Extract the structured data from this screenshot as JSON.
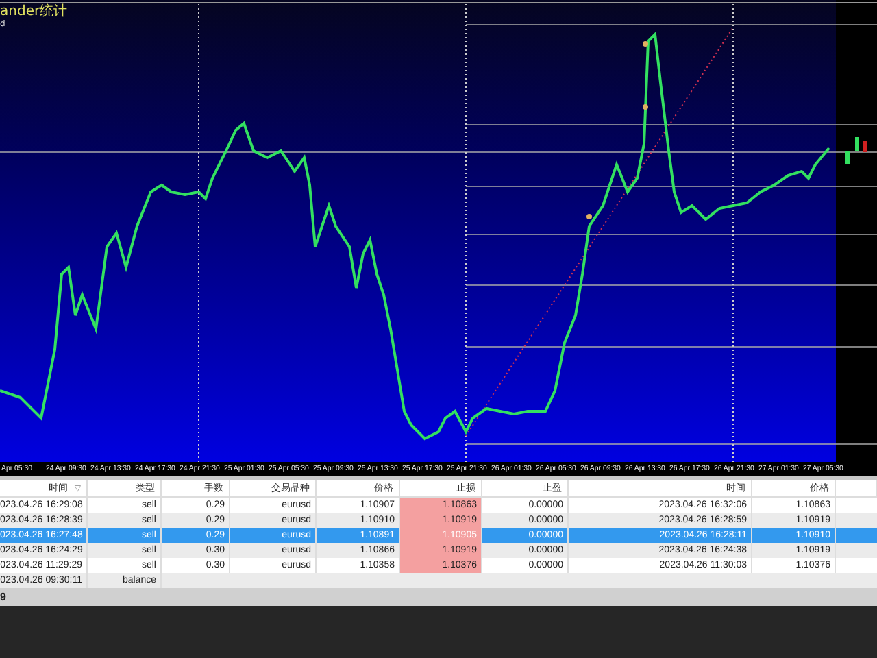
{
  "chart": {
    "title_lines": [
      "ander统计",
      "d"
    ],
    "time_axis": [
      "Apr 05:30",
      "24 Apr 09:30",
      "24 Apr 13:30",
      "24 Apr 17:30",
      "24 Apr 21:30",
      "25 Apr 01:30",
      "25 Apr 05:30",
      "25 Apr 09:30",
      "25 Apr 13:30",
      "25 Apr 17:30",
      "25 Apr 21:30",
      "26 Apr 01:30",
      "26 Apr 05:30",
      "26 Apr 09:30",
      "26 Apr 13:30",
      "26 Apr 17:30",
      "26 Apr 21:30",
      "27 Apr 01:30",
      "27 Apr 05:30"
    ]
  },
  "table": {
    "columns": [
      {
        "label": "时间",
        "sort_mark": "▽"
      },
      {
        "label": "类型"
      },
      {
        "label": "手数"
      },
      {
        "label": "交易品种"
      },
      {
        "label": "价格"
      },
      {
        "label": "止损"
      },
      {
        "label": "止盈"
      },
      {
        "label": "时间"
      },
      {
        "label": "价格"
      }
    ],
    "rows": [
      {
        "selected": false,
        "stop_loss_highlight": true,
        "cells": [
          "023.04.26 16:29:08",
          "sell",
          "0.29",
          "eurusd",
          "1.10907",
          "1.10863",
          "0.00000",
          "2023.04.26 16:32:06",
          "1.10863"
        ]
      },
      {
        "selected": false,
        "stop_loss_highlight": true,
        "cells": [
          "023.04.26 16:28:39",
          "sell",
          "0.29",
          "eurusd",
          "1.10910",
          "1.10919",
          "0.00000",
          "2023.04.26 16:28:59",
          "1.10919"
        ]
      },
      {
        "selected": true,
        "stop_loss_highlight": true,
        "cells": [
          "023.04.26 16:27:48",
          "sell",
          "0.29",
          "eurusd",
          "1.10891",
          "1.10905",
          "0.00000",
          "2023.04.26 16:28:11",
          "1.10910"
        ]
      },
      {
        "selected": false,
        "stop_loss_highlight": true,
        "cells": [
          "023.04.26 16:24:29",
          "sell",
          "0.30",
          "eurusd",
          "1.10866",
          "1.10919",
          "0.00000",
          "2023.04.26 16:24:38",
          "1.10919"
        ]
      },
      {
        "selected": false,
        "stop_loss_highlight": true,
        "cells": [
          "023.04.26 11:29:29",
          "sell",
          "0.30",
          "eurusd",
          "1.10358",
          "1.10376",
          "0.00000",
          "2023.04.26 11:30:03",
          "1.10376"
        ]
      },
      {
        "selected": false,
        "cells": [
          "023.04.26 09:30:11",
          "balance"
        ]
      }
    ]
  },
  "footer": "9"
}
